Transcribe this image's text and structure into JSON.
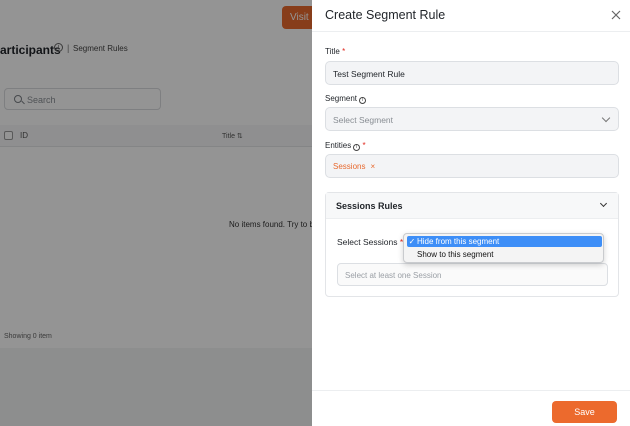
{
  "background": {
    "visit_button_label": "Visit l",
    "page_title": "articipants",
    "breadcrumb_separator": "|",
    "breadcrumb": "Segment Rules",
    "search_placeholder": "Search",
    "table_headers": [
      "ID",
      "Title ⇅"
    ],
    "empty_message": "No items found. Try to b",
    "item_count": "Showing 0 item"
  },
  "drawer": {
    "title": "Create Segment Rule",
    "fields": {
      "title": {
        "label": "Title",
        "value": "Test Segment Rule"
      },
      "segment": {
        "label": "Segment",
        "placeholder": "Select Segment"
      },
      "entities": {
        "label": "Entities",
        "chips": [
          "Sessions"
        ]
      }
    },
    "rules_panel": {
      "title": "Sessions Rules",
      "select_label": "Select Sessions",
      "session_placeholder": "Select at least one Session"
    },
    "dropdown": {
      "selected_mark": "✓",
      "options": [
        "Hide from this segment",
        "Show to this segment"
      ]
    },
    "save_label": "Save"
  },
  "colors": {
    "accent": "#ec6a2d",
    "required": "#e0281e",
    "dropdown_highlight": "#3d8ef7"
  }
}
